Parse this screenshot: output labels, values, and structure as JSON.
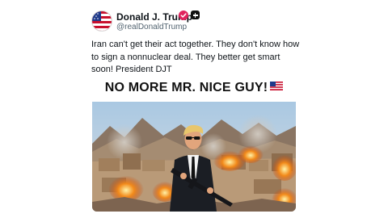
{
  "post": {
    "author": {
      "name": "Donald J. Trump",
      "handle": "@realDonaldTrump",
      "avatar_icon": "us-flag-avatar-icon",
      "verified_icon": "verified-badge-icon",
      "verified_color": "#e0245e"
    },
    "follow_icon": "plus-icon",
    "text": "Iran can't get their act together. They don't know how to sign a nonnuclear deal. They better get smart soon! President DJT",
    "media": {
      "caption": "NO MORE MR. NICE GUY!",
      "caption_flag_icon": "us-flag-icon"
    }
  }
}
